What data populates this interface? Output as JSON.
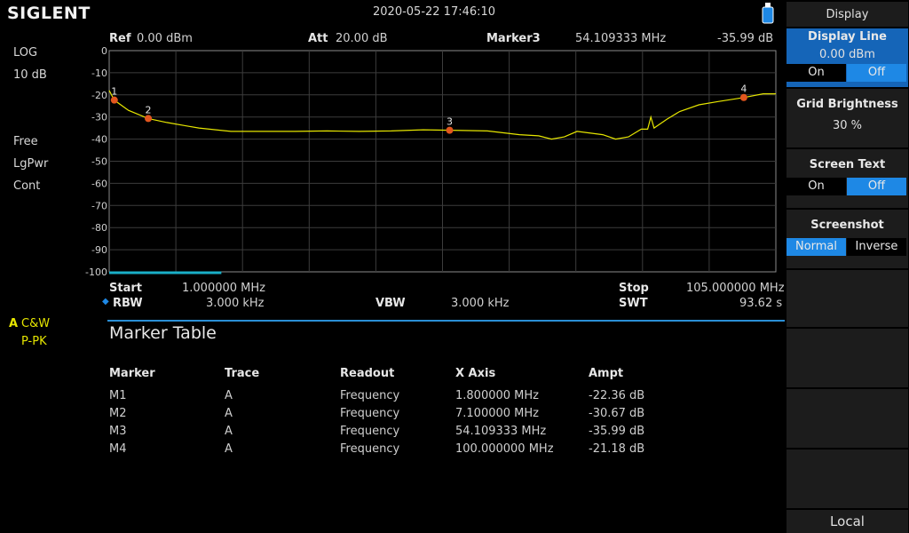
{
  "brand": "SIGLENT",
  "datetime": "2020-05-22   17:46:10",
  "header": {
    "ref_label": "Ref",
    "ref_value": "0.00 dBm",
    "att_label": "Att",
    "att_value": "20.00 dB",
    "marker_label": "Marker3",
    "marker_freq": "54.109333 MHz",
    "marker_ampl": "-35.99 dB"
  },
  "left": {
    "scale_mode": "LOG",
    "scale_div": "10 dB",
    "sweep": "Free",
    "det_power": "LgPwr",
    "cont": "Cont",
    "trace_letter": "A",
    "trace_mode": "C&W",
    "trace_det": "P-PK"
  },
  "footer": {
    "start_label": "Start",
    "start_value": "1.000000 MHz",
    "stop_label": "Stop",
    "stop_value": "105.000000 MHz",
    "rbw_label": "RBW",
    "rbw_value": "3.000 kHz",
    "vbw_label": "VBW",
    "vbw_value": "3.000 kHz",
    "swt_label": "SWT",
    "swt_value": "93.62 s"
  },
  "marker_table": {
    "title": "Marker Table",
    "headers": [
      "Marker",
      "Trace",
      "Readout",
      "X Axis",
      "Ampt"
    ],
    "rows": [
      [
        "M1",
        "A",
        "Frequency",
        "1.800000 MHz",
        "-22.36 dB"
      ],
      [
        "M2",
        "A",
        "Frequency",
        "7.100000 MHz",
        "-30.67 dB"
      ],
      [
        "M3",
        "A",
        "Frequency",
        "54.109333 MHz",
        "-35.99 dB"
      ],
      [
        "M4",
        "A",
        "Frequency",
        "100.000000 MHz",
        "-21.18 dB"
      ]
    ]
  },
  "panel": {
    "title": "Display",
    "display_line_label": "Display Line",
    "display_line_value": "0.00 dBm",
    "display_line_on": "On",
    "display_line_off": "Off",
    "grid_brightness_label": "Grid Brightness",
    "grid_brightness_value": "30 %",
    "screen_text_label": "Screen Text",
    "screen_text_on": "On",
    "screen_text_off": "Off",
    "screenshot_label": "Screenshot",
    "screenshot_normal": "Normal",
    "screenshot_inverse": "Inverse",
    "local_label": "Local"
  },
  "colors": {
    "trace": "#e6e600",
    "marker": "#e2561e",
    "accent": "#1e88e5",
    "grid": "#3c3c3c"
  },
  "chart_data": {
    "type": "line",
    "xlabel": "",
    "ylabel": "",
    "xlim": [
      1.0,
      105.0
    ],
    "ylim": [
      -100,
      0
    ],
    "y_ticks": [
      "0",
      "-10",
      "-20",
      "-30",
      "-40",
      "-50",
      "-60",
      "-70",
      "-80",
      "-90",
      "-100"
    ],
    "grid": true,
    "series": [
      {
        "x": [
          1.0,
          1.8,
          4.0,
          7.1,
          10,
          13,
          15,
          20,
          25,
          30,
          35,
          40,
          45,
          50,
          54.1,
          60,
          65,
          68,
          70,
          72,
          74,
          78,
          80,
          82,
          84,
          85,
          85.5,
          86,
          88,
          90,
          93,
          96,
          100,
          103,
          105
        ],
        "y": [
          -18,
          -22.4,
          -27,
          -30.7,
          -32.5,
          -34,
          -35,
          -36.5,
          -36.5,
          -36.5,
          -36.3,
          -36.5,
          -36.3,
          -35.8,
          -36,
          -36.3,
          -38,
          -38.5,
          -40,
          -39,
          -36.5,
          -38,
          -40,
          -39,
          -35.5,
          -35.5,
          -30,
          -35,
          -31,
          -27.5,
          -24.5,
          -23,
          -21.2,
          -19.5,
          -19.5
        ]
      }
    ],
    "markers": [
      {
        "id": "1",
        "x": 1.8,
        "y": -22.36
      },
      {
        "id": "2",
        "x": 7.1,
        "y": -30.67
      },
      {
        "id": "3",
        "x": 54.109333,
        "y": -35.99
      },
      {
        "id": "4",
        "x": 100.0,
        "y": -21.18
      }
    ]
  }
}
